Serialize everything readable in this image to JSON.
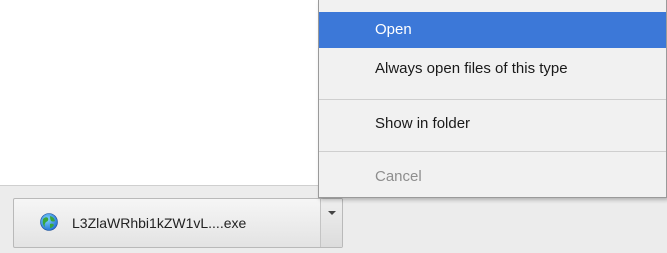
{
  "download_shelf": {
    "file_name": "L3ZlaWRhbi1kZW1vL....exe",
    "file_icon": "globe-icon",
    "menu_toggle_icon": "chevron-down-icon"
  },
  "context_menu": {
    "items": [
      {
        "label": "Open",
        "state": "highlighted"
      },
      {
        "label": "Always open files of this type",
        "state": "normal"
      },
      {
        "label": "Show in folder",
        "state": "normal"
      },
      {
        "label": "Cancel",
        "state": "disabled"
      }
    ]
  },
  "colors": {
    "highlight": "#3c78d8",
    "menu_background": "#f1f1f1",
    "disabled_text": "#8e8e8e",
    "shelf_background": "#ececec"
  }
}
